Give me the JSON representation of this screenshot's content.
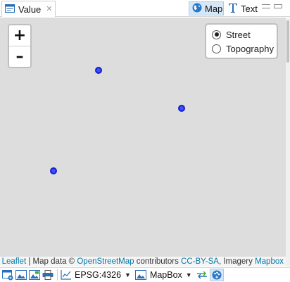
{
  "tabs": {
    "value_label": "Value",
    "close_glyph": "✕",
    "map_label": "Map",
    "text_label": "Text"
  },
  "map": {
    "background_color": "#dddddd",
    "zoom_in_label": "+",
    "zoom_out_label": "–",
    "layers": [
      {
        "label": "Street",
        "checked": true
      },
      {
        "label": "Topography",
        "checked": false
      }
    ],
    "marker_color": "#3355ff",
    "attribution": {
      "leaflet": "Leaflet",
      "sep": " | Map data © ",
      "osm": "OpenStreetMap",
      "contributors": " contributors ",
      "license": "CC-BY-SA",
      "imagery": ", Imagery ",
      "provider": "Mapbox"
    }
  },
  "toolbar": {
    "crs_label": "EPSG:4326",
    "tile_label": "MapBox",
    "icons": [
      "new-map-icon",
      "image-icon",
      "image-export-icon",
      "print-icon",
      "chart-icon",
      "image-icon",
      "swap-arrows-icon",
      "palette-icon"
    ]
  }
}
